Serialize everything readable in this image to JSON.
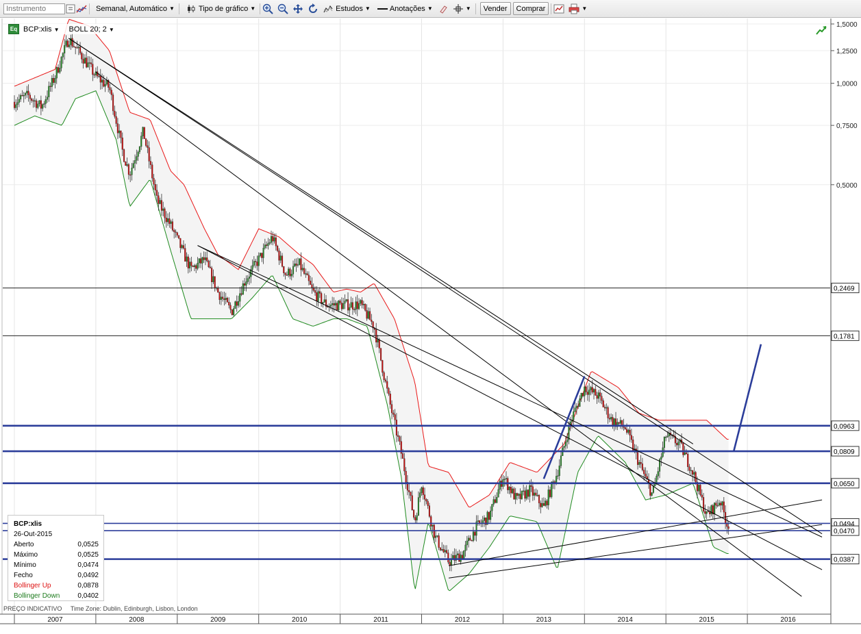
{
  "toolbar": {
    "instrument_placeholder": "Instrumento",
    "period_label": "Semanal,  Automático",
    "chart_type_label": "Tipo de gráfico",
    "studies_label": "Estudos",
    "annotations_label": "Anotações",
    "sell_label": "Vender",
    "buy_label": "Comprar"
  },
  "legend": {
    "badge": "Eq",
    "instrument": "BCP:xlis",
    "indicator": "BOLL 20; 2"
  },
  "info_panel": {
    "title": "BCP:xlis",
    "date": "26-Out-2015",
    "rows": [
      {
        "label": "Aberto",
        "value": "0,0525"
      },
      {
        "label": "Máximo",
        "value": "0,0525"
      },
      {
        "label": "Mínimo",
        "value": "0,0474"
      },
      {
        "label": "Fecho",
        "value": "0,0492"
      },
      {
        "label": "Bollinger Up",
        "value": "0,0878"
      },
      {
        "label": "Bollinger Down",
        "value": "0,0402"
      }
    ]
  },
  "footer": {
    "price_note": "PREÇO INDICATIVO",
    "timezone": "Time Zone: Dublin, Edinburgh, Lisbon, London"
  },
  "colors": {
    "bollinger_up": "#e81818",
    "bollinger_down": "#1e8a1e",
    "band_fill": "#f4f4f4",
    "candle_up": "#2a8a2a",
    "candle_down": "#c81414",
    "support_lines": "#2b3d9a",
    "trend_lines": "#000000"
  },
  "chart_data": {
    "type": "candlestick",
    "instrument": "BCP:xlis",
    "interval": "weekly",
    "y_scale": "log",
    "ylim": [
      0.025,
      1.5
    ],
    "y_ticks": [
      {
        "value": 1.5,
        "label": "1,5000"
      },
      {
        "value": 1.25,
        "label": "1,2500"
      },
      {
        "value": 1.0,
        "label": "1,0000"
      },
      {
        "value": 0.75,
        "label": "0,7500"
      },
      {
        "value": 0.5,
        "label": "0,5000"
      }
    ],
    "x_range": [
      "2007-01",
      "2016-12"
    ],
    "x_ticks": [
      "2007",
      "2008",
      "2009",
      "2010",
      "2011",
      "2012",
      "2013",
      "2014",
      "2015",
      "2016"
    ],
    "horizontal_levels": [
      {
        "value": 0.2469,
        "label": "0,2469",
        "style": "thin"
      },
      {
        "value": 0.1781,
        "label": "0,1781",
        "style": "thin"
      },
      {
        "value": 0.0963,
        "label": "0,0963",
        "style": "bold"
      },
      {
        "value": 0.0809,
        "label": "0,0809",
        "style": "bold"
      },
      {
        "value": 0.065,
        "label": "0,0650",
        "style": "bold"
      },
      {
        "value": 0.0494,
        "label": "0,0494",
        "style": "medium"
      },
      {
        "value": 0.047,
        "label": "0,0470",
        "style": "medium"
      },
      {
        "value": 0.0387,
        "label": "0,0387",
        "style": "bold"
      }
    ],
    "price_path": [
      [
        "2007-01",
        0.88
      ],
      [
        "2007-03",
        0.92
      ],
      [
        "2007-05",
        0.85
      ],
      [
        "2007-07",
        1.05
      ],
      [
        "2007-09",
        1.36
      ],
      [
        "2007-11",
        1.2
      ],
      [
        "2008-01",
        1.05
      ],
      [
        "2008-03",
        0.97
      ],
      [
        "2008-05",
        0.62
      ],
      [
        "2008-06",
        0.54
      ],
      [
        "2008-08",
        0.72
      ],
      [
        "2008-10",
        0.45
      ],
      [
        "2008-12",
        0.38
      ],
      [
        "2009-03",
        0.28
      ],
      [
        "2009-05",
        0.3
      ],
      [
        "2009-07",
        0.24
      ],
      [
        "2009-09",
        0.21
      ],
      [
        "2009-11",
        0.26
      ],
      [
        "2010-01",
        0.3
      ],
      [
        "2010-03",
        0.35
      ],
      [
        "2010-05",
        0.27
      ],
      [
        "2010-07",
        0.29
      ],
      [
        "2010-09",
        0.24
      ],
      [
        "2010-11",
        0.22
      ],
      [
        "2011-02",
        0.22
      ],
      [
        "2011-04",
        0.22
      ],
      [
        "2011-06",
        0.19
      ],
      [
        "2011-08",
        0.12
      ],
      [
        "2011-10",
        0.08
      ],
      [
        "2011-12",
        0.05
      ],
      [
        "2012-01",
        0.065
      ],
      [
        "2012-03",
        0.045
      ],
      [
        "2012-05",
        0.038
      ],
      [
        "2012-07",
        0.04
      ],
      [
        "2012-09",
        0.048
      ],
      [
        "2012-11",
        0.052
      ],
      [
        "2013-01",
        0.068
      ],
      [
        "2013-03",
        0.058
      ],
      [
        "2013-05",
        0.062
      ],
      [
        "2013-07",
        0.055
      ],
      [
        "2013-09",
        0.07
      ],
      [
        "2013-11",
        0.1
      ],
      [
        "2014-01",
        0.125
      ],
      [
        "2014-03",
        0.118
      ],
      [
        "2014-05",
        0.1
      ],
      [
        "2014-07",
        0.095
      ],
      [
        "2014-09",
        0.075
      ],
      [
        "2014-11",
        0.06
      ],
      [
        "2015-01",
        0.09
      ],
      [
        "2015-03",
        0.085
      ],
      [
        "2015-05",
        0.07
      ],
      [
        "2015-07",
        0.052
      ],
      [
        "2015-09",
        0.058
      ],
      [
        "2015-10",
        0.0492
      ]
    ],
    "bollinger_up_path": [
      [
        "2007-01",
        0.98
      ],
      [
        "2007-07",
        1.1
      ],
      [
        "2007-09",
        1.55
      ],
      [
        "2007-12",
        1.48
      ],
      [
        "2008-03",
        1.25
      ],
      [
        "2008-06",
        0.82
      ],
      [
        "2008-09",
        0.78
      ],
      [
        "2008-12",
        0.55
      ],
      [
        "2009-02",
        0.5
      ],
      [
        "2009-05",
        0.37
      ],
      [
        "2009-07",
        0.31
      ],
      [
        "2009-10",
        0.28
      ],
      [
        "2010-01",
        0.37
      ],
      [
        "2010-04",
        0.35
      ],
      [
        "2010-07",
        0.31
      ],
      [
        "2010-09",
        0.29
      ],
      [
        "2010-12",
        0.24
      ],
      [
        "2011-02",
        0.245
      ],
      [
        "2011-04",
        0.24
      ],
      [
        "2011-06",
        0.255
      ],
      [
        "2011-09",
        0.2
      ],
      [
        "2011-12",
        0.13
      ],
      [
        "2012-02",
        0.073
      ],
      [
        "2012-05",
        0.07
      ],
      [
        "2012-08",
        0.055
      ],
      [
        "2012-11",
        0.06
      ],
      [
        "2013-02",
        0.075
      ],
      [
        "2013-06",
        0.07
      ],
      [
        "2013-10",
        0.085
      ],
      [
        "2014-02",
        0.14
      ],
      [
        "2014-06",
        0.125
      ],
      [
        "2014-09",
        0.105
      ],
      [
        "2014-12",
        0.1
      ],
      [
        "2015-03",
        0.1
      ],
      [
        "2015-07",
        0.1
      ],
      [
        "2015-10",
        0.0878
      ]
    ],
    "bollinger_down_path": [
      [
        "2007-01",
        0.75
      ],
      [
        "2007-04",
        0.8
      ],
      [
        "2007-08",
        0.75
      ],
      [
        "2007-10",
        0.9
      ],
      [
        "2008-01",
        0.95
      ],
      [
        "2008-04",
        0.68
      ],
      [
        "2008-06",
        0.43
      ],
      [
        "2008-09",
        0.52
      ],
      [
        "2008-12",
        0.32
      ],
      [
        "2009-03",
        0.2
      ],
      [
        "2009-06",
        0.2
      ],
      [
        "2009-09",
        0.2
      ],
      [
        "2009-12",
        0.23
      ],
      [
        "2010-03",
        0.27
      ],
      [
        "2010-06",
        0.2
      ],
      [
        "2010-09",
        0.19
      ],
      [
        "2010-12",
        0.2
      ],
      [
        "2011-02",
        0.2
      ],
      [
        "2011-05",
        0.19
      ],
      [
        "2011-08",
        0.11
      ],
      [
        "2011-10",
        0.068
      ],
      [
        "2011-12",
        0.031
      ],
      [
        "2012-02",
        0.05
      ],
      [
        "2012-05",
        0.031
      ],
      [
        "2012-08",
        0.035
      ],
      [
        "2012-11",
        0.042
      ],
      [
        "2013-02",
        0.052
      ],
      [
        "2013-06",
        0.05
      ],
      [
        "2013-09",
        0.036
      ],
      [
        "2013-12",
        0.07
      ],
      [
        "2014-03",
        0.09
      ],
      [
        "2014-07",
        0.075
      ],
      [
        "2014-10",
        0.058
      ],
      [
        "2015-01",
        0.06
      ],
      [
        "2015-05",
        0.065
      ],
      [
        "2015-08",
        0.042
      ],
      [
        "2015-10",
        0.0402
      ]
    ],
    "trend_lines": [
      {
        "from": [
          "2007-09",
          1.36
        ],
        "to": [
          "2015-05",
          0.085
        ]
      },
      {
        "from": [
          "2007-09",
          1.36
        ],
        "to": [
          "2016-12",
          0.046
        ]
      },
      {
        "from": [
          "2008-01",
          1.08
        ],
        "to": [
          "2016-09",
          0.03
        ]
      },
      {
        "from": [
          "2009-04",
          0.33
        ],
        "to": [
          "2016-12",
          0.036
        ]
      },
      {
        "from": [
          "2009-04",
          0.33
        ],
        "to": [
          "2016-12",
          0.045
        ]
      },
      {
        "from": [
          "2012-05",
          0.037
        ],
        "to": [
          "2016-12",
          0.058
        ]
      },
      {
        "from": [
          "2012-05",
          0.034
        ],
        "to": [
          "2016-12",
          0.049
        ]
      }
    ],
    "projection_lines": [
      {
        "from": [
          "2013-07",
          0.067
        ],
        "to": [
          "2014-01",
          0.135
        ]
      },
      {
        "from": [
          "2015-11",
          0.081
        ],
        "to": [
          "2016-03",
          0.168
        ]
      }
    ]
  }
}
